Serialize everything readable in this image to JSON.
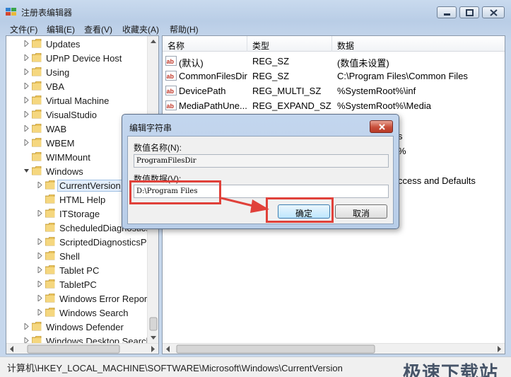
{
  "window": {
    "title": "注册表编辑器",
    "menu": [
      "文件(F)",
      "编辑(E)",
      "查看(V)",
      "收藏夹(A)",
      "帮助(H)"
    ]
  },
  "tree": {
    "items": [
      {
        "label": "Updates",
        "level": 1,
        "expander": "right",
        "selected": false
      },
      {
        "label": "UPnP Device Host",
        "level": 1,
        "expander": "right",
        "selected": false
      },
      {
        "label": "Using",
        "level": 1,
        "expander": "right",
        "selected": false
      },
      {
        "label": "VBA",
        "level": 1,
        "expander": "right",
        "selected": false
      },
      {
        "label": "Virtual Machine",
        "level": 1,
        "expander": "right",
        "selected": false
      },
      {
        "label": "VisualStudio",
        "level": 1,
        "expander": "right",
        "selected": false
      },
      {
        "label": "WAB",
        "level": 1,
        "expander": "right",
        "selected": false
      },
      {
        "label": "WBEM",
        "level": 1,
        "expander": "right",
        "selected": false
      },
      {
        "label": "WIMMount",
        "level": 1,
        "expander": "none",
        "selected": false
      },
      {
        "label": "Windows",
        "level": 1,
        "expander": "down",
        "selected": false
      },
      {
        "label": "CurrentVersion",
        "level": 2,
        "expander": "right",
        "selected": true
      },
      {
        "label": "HTML Help",
        "level": 2,
        "expander": "none",
        "selected": false
      },
      {
        "label": "ITStorage",
        "level": 2,
        "expander": "right",
        "selected": false
      },
      {
        "label": "ScheduledDiagnostics",
        "level": 2,
        "expander": "none",
        "selected": false
      },
      {
        "label": "ScriptedDiagnosticsProvider",
        "level": 2,
        "expander": "right",
        "selected": false
      },
      {
        "label": "Shell",
        "level": 2,
        "expander": "right",
        "selected": false
      },
      {
        "label": "Tablet PC",
        "level": 2,
        "expander": "right",
        "selected": false
      },
      {
        "label": "TabletPC",
        "level": 2,
        "expander": "right",
        "selected": false
      },
      {
        "label": "Windows Error Reporting",
        "level": 2,
        "expander": "right",
        "selected": false
      },
      {
        "label": "Windows Search",
        "level": 2,
        "expander": "right",
        "selected": false
      },
      {
        "label": "Windows Defender",
        "level": 1,
        "expander": "right",
        "selected": false
      },
      {
        "label": "Windows Desktop Search",
        "level": 1,
        "expander": "right",
        "selected": false
      }
    ]
  },
  "list": {
    "columns": [
      "名称",
      "类型",
      "数据"
    ],
    "rows": [
      {
        "name": "(默认)",
        "type": "REG_SZ",
        "data": "(数值未设置)"
      },
      {
        "name": "CommonFilesDir",
        "type": "REG_SZ",
        "data": "C:\\Program Files\\Common Files"
      },
      {
        "name": "DevicePath",
        "type": "REG_MULTI_SZ",
        "data": "%SystemRoot%\\inf"
      },
      {
        "name": "MediaPathUne...",
        "type": "REG_EXPAND_SZ",
        "data": "%SystemRoot%\\Media"
      }
    ],
    "partial_behind_dialog": [
      "s",
      "%",
      "ccess and Defaults"
    ]
  },
  "dialog": {
    "title": "编辑字符串",
    "name_label": "数值名称(N):",
    "name_value": "ProgramFilesDir",
    "data_label": "数值数据(V):",
    "data_value": "D:\\Program Files",
    "ok_label": "确定",
    "cancel_label": "取消"
  },
  "status": {
    "path": "计算机\\HKEY_LOCAL_MACHINE\\SOFTWARE\\Microsoft\\Windows\\CurrentVersion"
  },
  "watermark": "极速下载站",
  "colors": {
    "highlight": "#e0413a",
    "folder": "#e8c15a",
    "selection": "#e3eefb"
  }
}
